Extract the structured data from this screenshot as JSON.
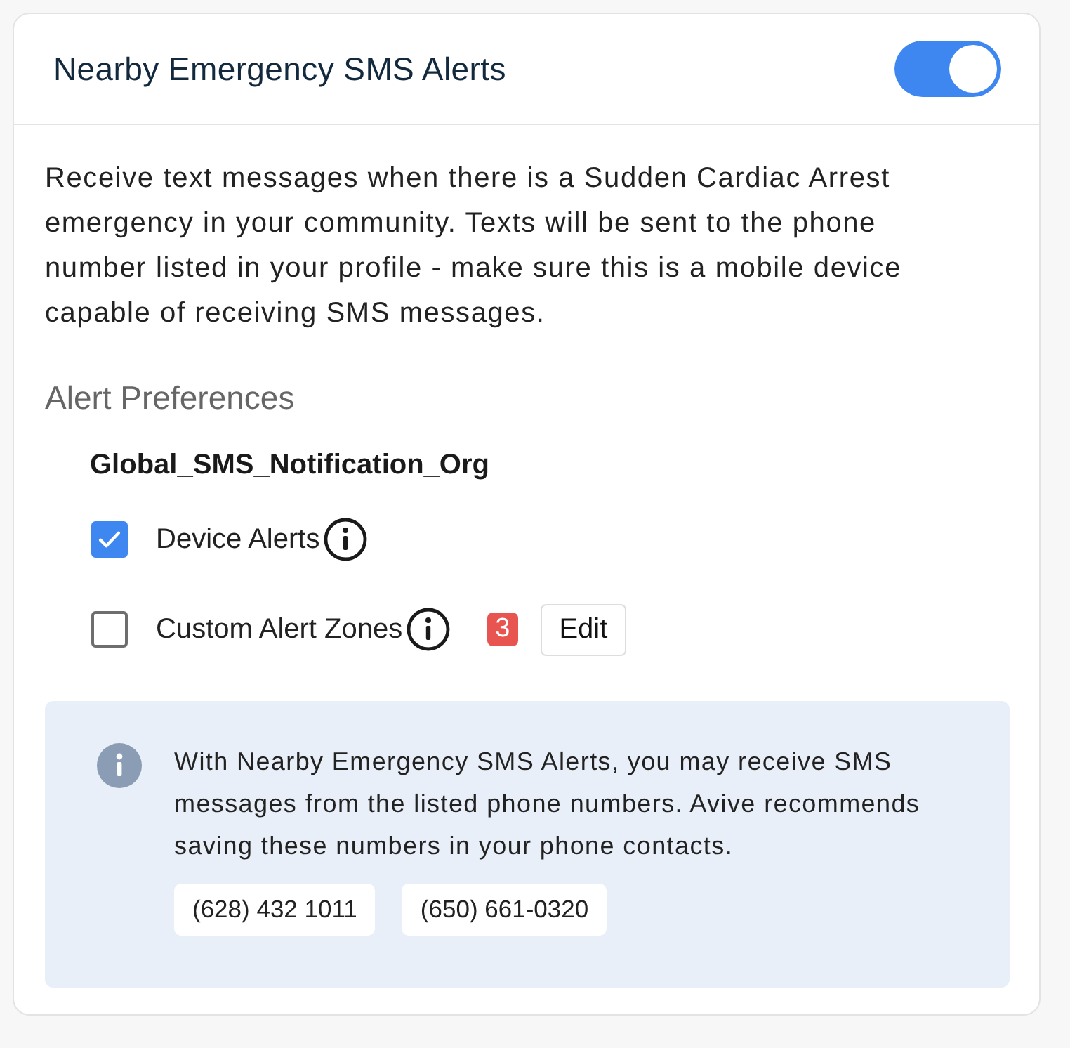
{
  "card": {
    "title": "Nearby Emergency SMS Alerts",
    "enabled": true
  },
  "description": "Receive text messages when there is a Sudden Cardiac Arrest emergency in your community. Texts will be sent to the phone number listed in your profile - make sure this is a mobile device capable of receiving SMS messages.",
  "preferences": {
    "heading": "Alert Preferences",
    "group": "Global_SMS_Notification_Org",
    "options": [
      {
        "label": "Device Alerts",
        "checked": true
      },
      {
        "label": "Custom Alert Zones",
        "checked": false,
        "badge": "3",
        "action": "Edit"
      }
    ]
  },
  "notice": {
    "text": "With Nearby Emergency SMS Alerts, you may receive SMS messages from the listed phone numbers. Avive recommends saving these numbers in your phone contacts.",
    "phone_numbers": [
      "(628) 432 1011",
      "(650) 661-0320"
    ]
  }
}
